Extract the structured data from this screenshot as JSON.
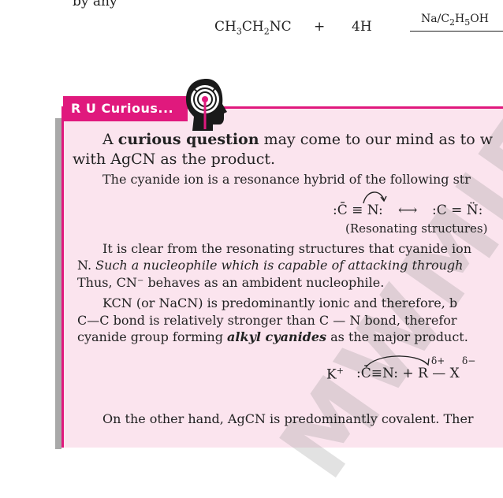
{
  "top": {
    "lead": "by any",
    "reactant1": "CH₃CH₂NC",
    "plus": "+",
    "reactant2": "4H",
    "reagent": "Na/C₂H₅OH"
  },
  "box": {
    "tab_label": "R U Curious...",
    "p1_start": "A ",
    "p1_bold": "curious question",
    "p1_rest": " may come to our mind as to w",
    "p1_line2": "with AgCN as the product.",
    "p2": "The cyanide ion is a resonance hybrid of the following str",
    "resonance_left": ":C̄ ≡ N:",
    "resonance_arrow": "⟷",
    "resonance_right": ":C = N̈:",
    "resonance_caption": "(Resonating structures)",
    "p3_line1": "It is clear from the resonating structures that cyanide ion",
    "p3_line2_start": "N. ",
    "p3_line2_italic": "Such a nucleophile which is capable of attacking through",
    "p3_line3": "Thus, CN⁻ behaves as an ambident nucleophile.",
    "p4_line1": "KCN (or NaCN) is predominantly ionic and therefore, b",
    "p4_line2": "C—C bond is relatively stronger than C — N bond, therefor",
    "p4_line3_start": "cyanide group forming ",
    "p4_line3_bolditalic": "alkyl cyanides",
    "p4_line3_end": " as the major product.",
    "reaction_k": "K",
    "reaction_k_charge": "+",
    "reaction_cn": ":C̄≡N: + R — X",
    "delta_plus": "δ+",
    "delta_minus": "δ−",
    "p5_line1": "On the other hand, AgCN is predominantly covalent. Ther"
  },
  "watermark": "MWMJEE"
}
